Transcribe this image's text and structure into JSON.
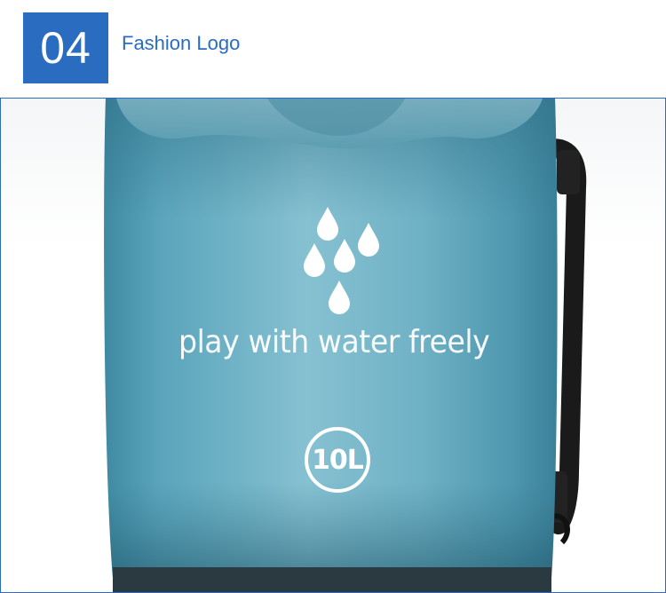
{
  "header": {
    "number": "04",
    "title": "Fashion Logo"
  },
  "photo": {
    "slogan": "play with water freely",
    "capacity": "10L",
    "icon": "water-drops-icon"
  },
  "colors": {
    "accent": "#2a6dc0",
    "bag": "#5fa5b8",
    "strap": "#1a1a1a"
  }
}
